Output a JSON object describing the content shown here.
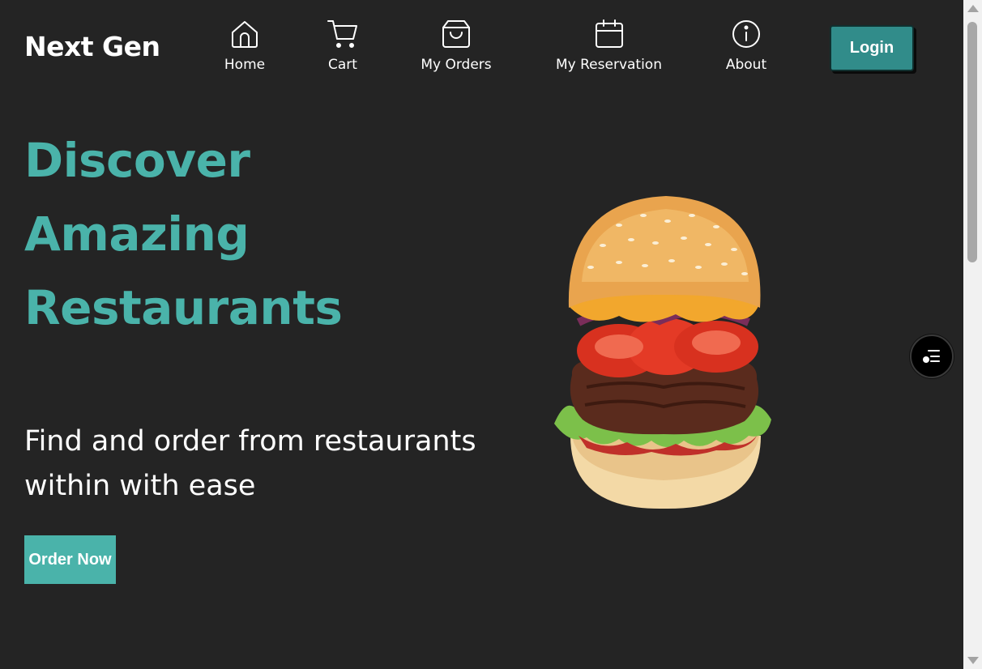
{
  "header": {
    "brand": "Next Gen",
    "nav": [
      {
        "label": "Home",
        "icon": "home-icon"
      },
      {
        "label": "Cart",
        "icon": "cart-icon"
      },
      {
        "label": "My Orders",
        "icon": "shopping-bag-icon"
      },
      {
        "label": "My Reservation",
        "icon": "calendar-icon"
      },
      {
        "label": "About",
        "icon": "info-icon"
      }
    ],
    "login_label": "Login"
  },
  "hero": {
    "headline": [
      "Discover",
      "Amazing",
      "Restaurants"
    ],
    "subtitle": "Find and order from restaurants within with ease",
    "order_label": "Order Now",
    "image": "burger-image"
  },
  "floating_button": {
    "icon": "menu-list-icon"
  },
  "colors": {
    "background": "#242424",
    "accent": "#4ab3aa",
    "login_button": "#318c8a",
    "text": "#ffffff"
  }
}
